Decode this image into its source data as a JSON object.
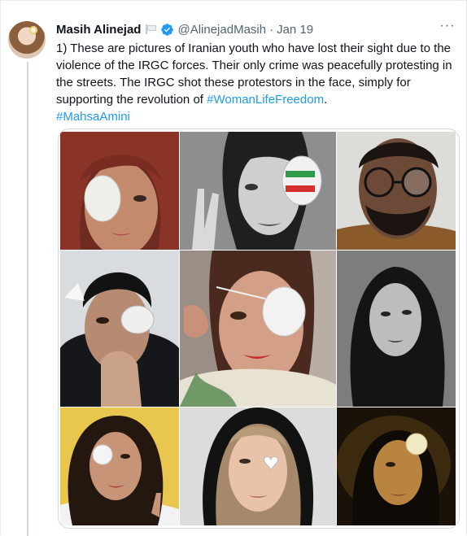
{
  "tweet": {
    "author_name": "Masih Alinejad",
    "handle": "@AlinejadMasih",
    "separator": "·",
    "date": "Jan 19",
    "more_label": "···",
    "text_lines": [
      "1) These are pictures of Iranian youth who have lost their sight due to the",
      "violence of the IRGC forces. Their only crime was peacefully protesting in",
      "the streets. The IRGC shot these protestors in the face, simply for",
      "supporting the revolution of "
    ],
    "hashtag_1": "#WomanLifeFreedom",
    "period": ".",
    "hashtag_2": "#MahsaAmini",
    "icons": {
      "avatar": "profile-photo",
      "flag": "white-flag-icon",
      "verified": "verified-badge-icon",
      "more": "more-options-icon"
    },
    "colors": {
      "link": "#1d9bf0",
      "verified": "#1d9bf0",
      "secondary_text": "#536471"
    }
  },
  "media": {
    "photo_count": 9
  }
}
